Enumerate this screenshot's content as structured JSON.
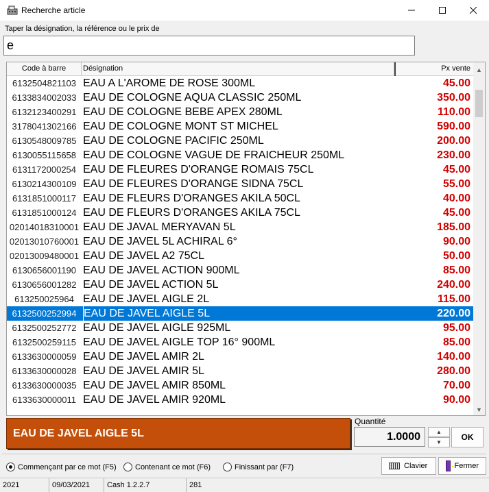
{
  "window": {
    "title": "Recherche article",
    "icon": "register-icon"
  },
  "search": {
    "label": "Taper la désignation, la référence ou le prix de",
    "value": "e"
  },
  "grid": {
    "columns": {
      "code": "Code à barre",
      "designation": "Désignation",
      "price": "Px vente"
    },
    "rows": [
      {
        "code": "6132504821103",
        "designation": "EAU A L'AROME DE ROSE 300ML",
        "price": "45.00"
      },
      {
        "code": "6133834002033",
        "designation": "EAU DE COLOGNE AQUA CLASSIC 250ML",
        "price": "350.00"
      },
      {
        "code": "6132123400291",
        "designation": "EAU DE COLOGNE BEBE APEX 280ML",
        "price": "110.00"
      },
      {
        "code": "3178041302166",
        "designation": "EAU DE COLOGNE MONT ST MICHEL",
        "price": "590.00"
      },
      {
        "code": "6130548009785",
        "designation": "EAU DE COLOGNE PACIFIC 250ML",
        "price": "200.00"
      },
      {
        "code": "6130055115658",
        "designation": "EAU DE COLOGNE VAGUE DE FRAICHEUR 250ML",
        "price": "230.00"
      },
      {
        "code": "6131172000254",
        "designation": "EAU DE FLEURES D'ORANGE ROMAIS 75CL",
        "price": "45.00"
      },
      {
        "code": "6130214300109",
        "designation": "EAU DE FLEURES D'ORANGE SIDNA 75CL",
        "price": "55.00"
      },
      {
        "code": "6131851000117",
        "designation": "EAU DE FLEURS D'ORANGES AKILA 50CL",
        "price": "40.00"
      },
      {
        "code": "6131851000124",
        "designation": "EAU DE FLEURS D'ORANGES AKILA 75CL",
        "price": "45.00"
      },
      {
        "code": "02014018310001",
        "designation": "EAU DE JAVAL MERYAVAN 5L",
        "price": "185.00"
      },
      {
        "code": "02013010760001",
        "designation": "EAU DE JAVEL 5L ACHIRAL 6°",
        "price": "90.00"
      },
      {
        "code": "02013009480001",
        "designation": "EAU DE JAVEL A2 75CL",
        "price": "50.00"
      },
      {
        "code": "6130656001190",
        "designation": "EAU DE JAVEL ACTION 900ML",
        "price": "85.00"
      },
      {
        "code": "6130656001282",
        "designation": "EAU DE JAVEL ACTION 5L",
        "price": "240.00"
      },
      {
        "code": "613250025964",
        "designation": "EAU DE JAVEL AIGLE 2L",
        "price": "115.00"
      },
      {
        "code": "6132500252994",
        "designation": "EAU DE JAVEL AIGLE 5L",
        "price": "220.00"
      },
      {
        "code": "6132500252772",
        "designation": "EAU DE JAVEL AIGLE 925ML",
        "price": "95.00"
      },
      {
        "code": "6132500259115",
        "designation": "EAU DE JAVEL AIGLE TOP 16° 900ML",
        "price": "85.00"
      },
      {
        "code": "6133630000059",
        "designation": "EAU DE JAVEL AMIR 2L",
        "price": "140.00"
      },
      {
        "code": "6133630000028",
        "designation": "EAU DE JAVEL AMIR 5L",
        "price": "280.00"
      },
      {
        "code": "6133630000035",
        "designation": "EAU DE JAVEL AMIR 850ML",
        "price": "70.00"
      },
      {
        "code": "6133630000011",
        "designation": "EAU DE JAVEL AMIR 920ML",
        "price": "90.00"
      }
    ],
    "selected_index": 16
  },
  "selected_article": "EAU DE JAVEL AIGLE 5L",
  "quantity": {
    "label": "Quantité",
    "value": "1.0000"
  },
  "ok_label": "OK",
  "search_modes": [
    {
      "label": "Commençant par ce mot (F5)",
      "checked": true
    },
    {
      "label": "Contenant ce mot (F6)",
      "checked": false
    },
    {
      "label": "Finissant par (F7)",
      "checked": false
    }
  ],
  "buttons": {
    "clavier": "Clavier",
    "fermer": "Fermer"
  },
  "statusbar": [
    "2021",
    "09/03/2021",
    "Cash 1.2.2.7",
    "281"
  ],
  "colors": {
    "price_red": "#d20000",
    "selection_blue": "#0078d7",
    "banner_orange": "#c44f0a"
  }
}
